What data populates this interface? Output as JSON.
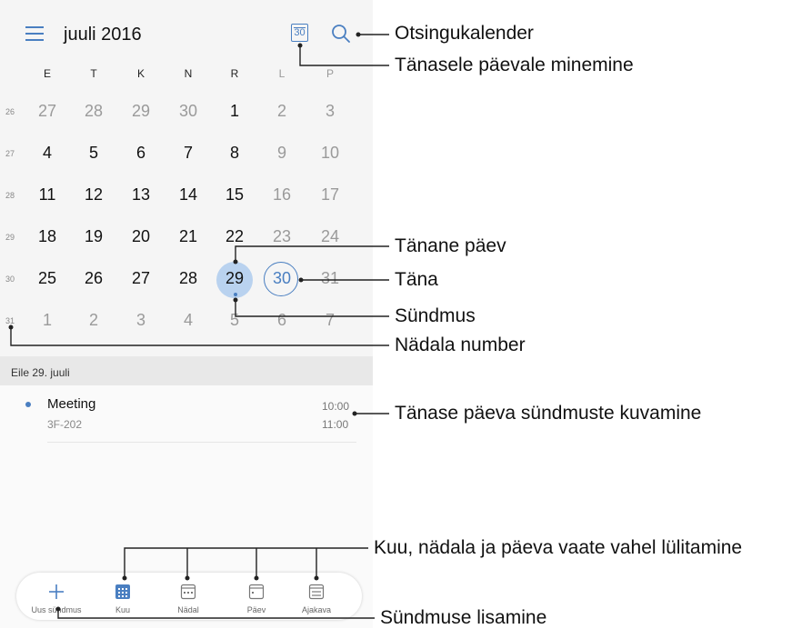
{
  "header": {
    "title": "juuli 2016",
    "today_icon_label": "30"
  },
  "weekdays": [
    "E",
    "T",
    "K",
    "N",
    "R",
    "L",
    "P"
  ],
  "weeks": [
    {
      "number": "26",
      "days": [
        "27",
        "28",
        "29",
        "30",
        "1",
        "2",
        "3"
      ]
    },
    {
      "number": "27",
      "days": [
        "4",
        "5",
        "6",
        "7",
        "8",
        "9",
        "10"
      ]
    },
    {
      "number": "28",
      "days": [
        "11",
        "12",
        "13",
        "14",
        "15",
        "16",
        "17"
      ]
    },
    {
      "number": "29",
      "days": [
        "18",
        "19",
        "20",
        "21",
        "22",
        "23",
        "24"
      ]
    },
    {
      "number": "30",
      "days": [
        "25",
        "26",
        "27",
        "28",
        "29",
        "30",
        "31"
      ]
    },
    {
      "number": "31",
      "days": [
        "1",
        "2",
        "3",
        "4",
        "5",
        "6",
        "7"
      ]
    }
  ],
  "events": {
    "header": "Eile 29. juuli",
    "items": [
      {
        "title": "Meeting",
        "location": "3F-202",
        "start": "10:00",
        "end": "11:00"
      }
    ]
  },
  "bottom_bar": {
    "items": [
      {
        "label": "Uus sündmus",
        "icon": "plus-icon"
      },
      {
        "label": "Kuu",
        "icon": "month-grid-icon"
      },
      {
        "label": "Nädal",
        "icon": "week-grid-icon"
      },
      {
        "label": "Päev",
        "icon": "day-view-icon"
      },
      {
        "label": "Ajakava",
        "icon": "agenda-icon"
      }
    ]
  },
  "callouts": {
    "search": "Otsingukalender",
    "go_today": "Tänasele päevale minemine",
    "selected_day": "Tänane päev",
    "today": "Täna",
    "event": "Sündmus",
    "week_number": "Nädala number",
    "day_events": "Tänase päeva sündmuste kuvamine",
    "view_switch": "Kuu, nädala ja päeva vaate vahel lülitamine",
    "add_event": "Sündmuse lisamine"
  },
  "colors": {
    "accent": "#4a7fc1",
    "selected_fill": "#b9d2ef",
    "grey_day": "#9a9a9a"
  }
}
